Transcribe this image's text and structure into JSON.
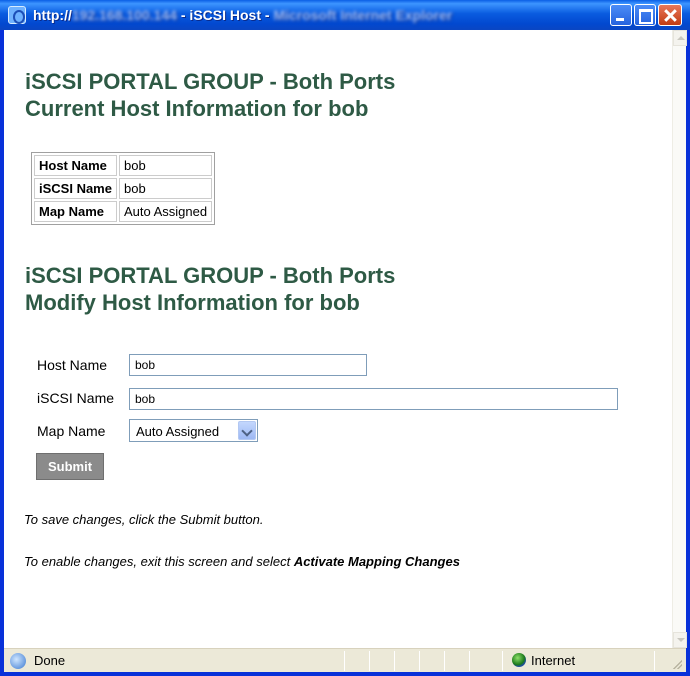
{
  "window": {
    "title_prefix": "http://",
    "title_blur_host": "192.168.100.144",
    "title_middle": " - iSCSI Host - ",
    "title_blur_app": "Microsoft Internet Explorer"
  },
  "current": {
    "heading_line1": "iSCSI PORTAL GROUP - Both Ports",
    "heading_line2": "Current Host Information for bob",
    "rows": [
      {
        "label": "Host Name",
        "value": "bob"
      },
      {
        "label": "iSCSI Name",
        "value": "bob"
      },
      {
        "label": "Map Name",
        "value": "Auto Assigned"
      }
    ]
  },
  "modify": {
    "heading_line1": "iSCSI PORTAL GROUP - Both Ports",
    "heading_line2": "Modify Host Information for bob",
    "host_name_label": "Host Name",
    "host_name_value": "bob",
    "iscsi_name_label": "iSCSI Name",
    "iscsi_name_value": "bob",
    "map_name_label": "Map Name",
    "map_name_value": "Auto Assigned",
    "submit_label": "Submit"
  },
  "notes": {
    "save": "To save changes, click the Submit button.",
    "enable_prefix": "To enable changes, exit this screen and select ",
    "enable_bold": "Activate Mapping Changes"
  },
  "status": {
    "text": "Done",
    "zone": "Internet"
  },
  "colors": {
    "heading": "#2e5a45",
    "titlebar": "#0a5ce0",
    "submit_bg": "#8b8b8b"
  }
}
